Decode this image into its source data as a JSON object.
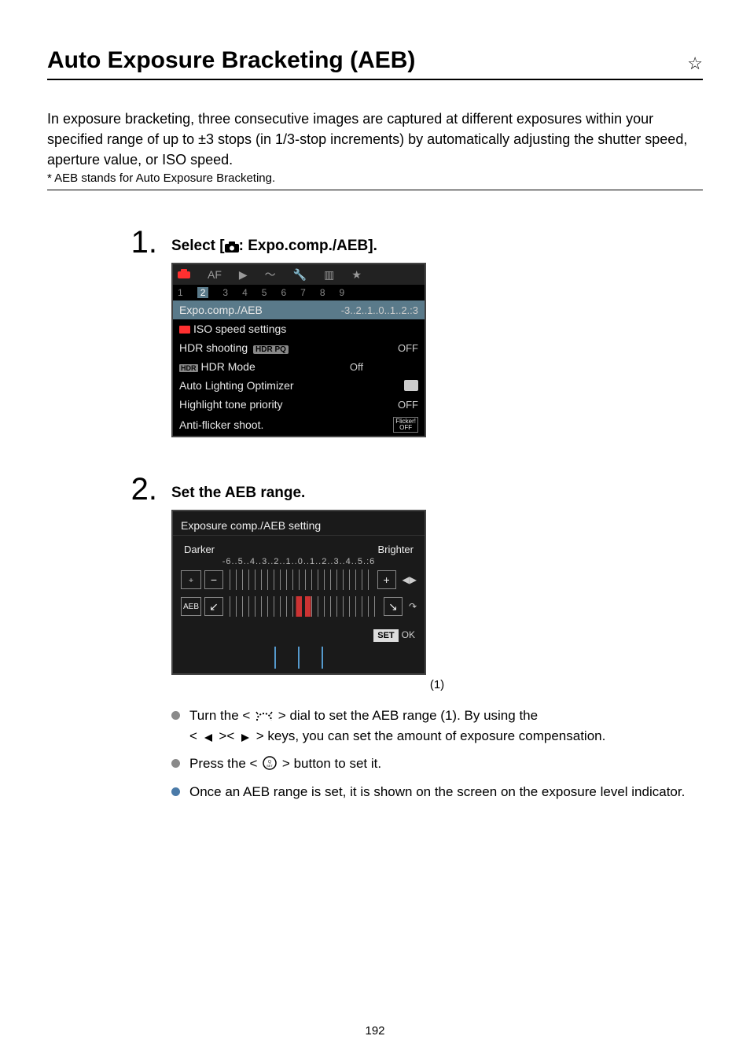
{
  "header": {
    "title": "Auto Exposure Bracketing (AEB)",
    "star": "☆"
  },
  "intro": "In exposure bracketing, three consecutive images are captured at different exposures within your specified range of up to ±3 stops (in 1/3-stop increments) by automatically adjusting the shutter speed, aperture value, or ISO speed.",
  "note": "* AEB stands for Auto Exposure Bracketing.",
  "steps": [
    {
      "num": "1.",
      "heading_prefix": "Select [",
      "heading_suffix": ": Expo.comp./AEB].",
      "menu": {
        "tabs_af": "AF",
        "nums": [
          "1",
          "2",
          "3",
          "4",
          "5",
          "6",
          "7",
          "8",
          "9"
        ],
        "rows": [
          {
            "label": "Expo.comp./AEB",
            "value": "-3..2..1..0..1..2.:3"
          },
          {
            "label": "ISO speed settings",
            "value": "",
            "redico": true
          },
          {
            "label": "HDR shooting",
            "value": "OFF",
            "hdrpq": "HDR PQ"
          },
          {
            "label": "HDR Mode",
            "value": "Off",
            "hdrico": "HDR"
          },
          {
            "label": "Auto Lighting Optimizer",
            "value": "",
            "optico": true
          },
          {
            "label": "Highlight tone priority",
            "value": "OFF"
          },
          {
            "label": "Anti-flicker shoot.",
            "value": "",
            "flicker_top": "Flicker!",
            "flicker_bot": "OFF"
          }
        ]
      }
    },
    {
      "num": "2.",
      "heading": "Set the AEB range.",
      "aeb": {
        "title": "Exposure comp./AEB setting",
        "darker": "Darker",
        "brighter": "Brighter",
        "scale": "-6..5..4..3..2..1..0..1..2..3..4..5.:6",
        "aeb_label": "AEB",
        "minus": "−",
        "plus": "+",
        "arrow_lr": "◀▶",
        "arrow_curve": "↷",
        "set": "SET",
        "ok": "OK",
        "caption": "(1)"
      },
      "bullets": [
        {
          "pre": "Turn the < ",
          "mid": " > dial to set the AEB range (1). By using the",
          "line2_pre": "< ",
          "line2_mid": " >< ",
          "line2_post": " > keys, you can set the amount of exposure compensation."
        },
        {
          "text_pre": "Press the < ",
          "text_post": " > button to set it."
        },
        {
          "text": "Once an AEB range is set, it is shown on the screen on the exposure level indicator."
        }
      ]
    }
  ],
  "page_number": "192"
}
